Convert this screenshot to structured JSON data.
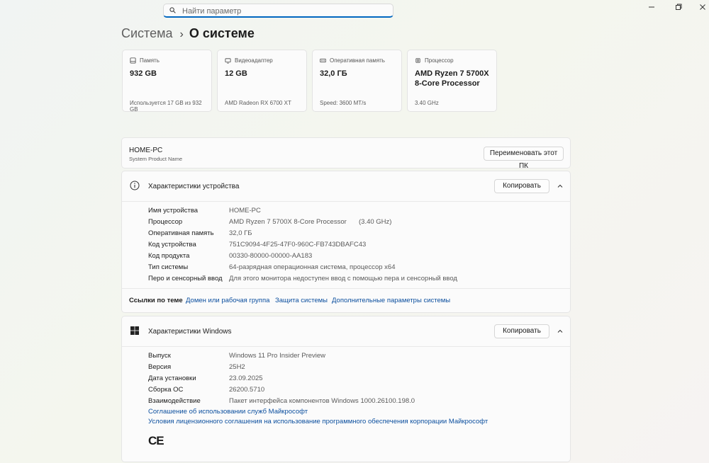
{
  "search": {
    "placeholder": "Найти параметр"
  },
  "window_controls": {
    "icons": [
      "minimize-icon",
      "maximize-icon",
      "close-icon"
    ]
  },
  "breadcrumb": {
    "parent": "Система",
    "separator": "›",
    "current": "О системе"
  },
  "cards": [
    {
      "icon": "storage-icon",
      "label": "Память",
      "value": "932 GB",
      "sub": "Используется 17 GB из 932 GB"
    },
    {
      "icon": "gpu-icon",
      "label": "Видеоадаптер",
      "value": "12 GB",
      "sub": "AMD Radeon RX 6700 XT"
    },
    {
      "icon": "ram-icon",
      "label": "Оперативная память",
      "value": "32,0 ГБ",
      "sub": "Speed: 3600 MT/s"
    },
    {
      "icon": "cpu-icon",
      "label": "Процессор",
      "value": "AMD Ryzen 7 5700X 8-Core Processor",
      "sub": "3.40 GHz"
    }
  ],
  "pc": {
    "name": "HOME-PC",
    "sub": "System Product Name",
    "rename_label": "Переименовать этот ПК"
  },
  "device_specs": {
    "title": "Характеристики устройства",
    "copy_label": "Копировать",
    "rows": [
      {
        "key": "Имя устройства",
        "value": "HOME-PC"
      },
      {
        "key": "Процессор",
        "value": "AMD Ryzen 7 5700X 8-Core Processor",
        "extra": "(3.40 GHz)"
      },
      {
        "key": "Оперативная память",
        "value": "32,0 ГБ"
      },
      {
        "key": "Код устройства",
        "value": "751C9094-4F25-47F0-960C-FB743DBAFC43"
      },
      {
        "key": "Код продукта",
        "value": "00330-80000-00000-AA183"
      },
      {
        "key": "Тип системы",
        "value": "64-разрядная операционная система, процессор x64"
      },
      {
        "key": "Перо и сенсорный ввод",
        "value": "Для этого монитора недоступен ввод с помощью пера и сенсорный ввод"
      }
    ]
  },
  "related_links": {
    "title": "Ссылки по теме",
    "links": [
      "Домен или рабочая группа",
      "Защита системы",
      "Дополнительные параметры системы"
    ]
  },
  "windows_specs": {
    "title": "Характеристики Windows",
    "copy_label": "Копировать",
    "rows": [
      {
        "key": "Выпуск",
        "value": "Windows 11 Pro Insider Preview"
      },
      {
        "key": "Версия",
        "value": "25H2"
      },
      {
        "key": "Дата установки",
        "value": "23.09.2025"
      },
      {
        "key": "Сборка ОС",
        "value": "26200.5710"
      },
      {
        "key": "Взаимодействие",
        "value": "Пакет интерфейса компонентов Windows 1000.26100.198.0"
      }
    ],
    "links": [
      "Соглашение об использовании служб Майкрософт",
      "Условия лицензионного соглашения на использование программного обеспечения корпорации Майкрософт"
    ],
    "ce_mark": "CE"
  },
  "colors": {
    "accent": "#0067c0",
    "link": "#0a4e9e"
  }
}
